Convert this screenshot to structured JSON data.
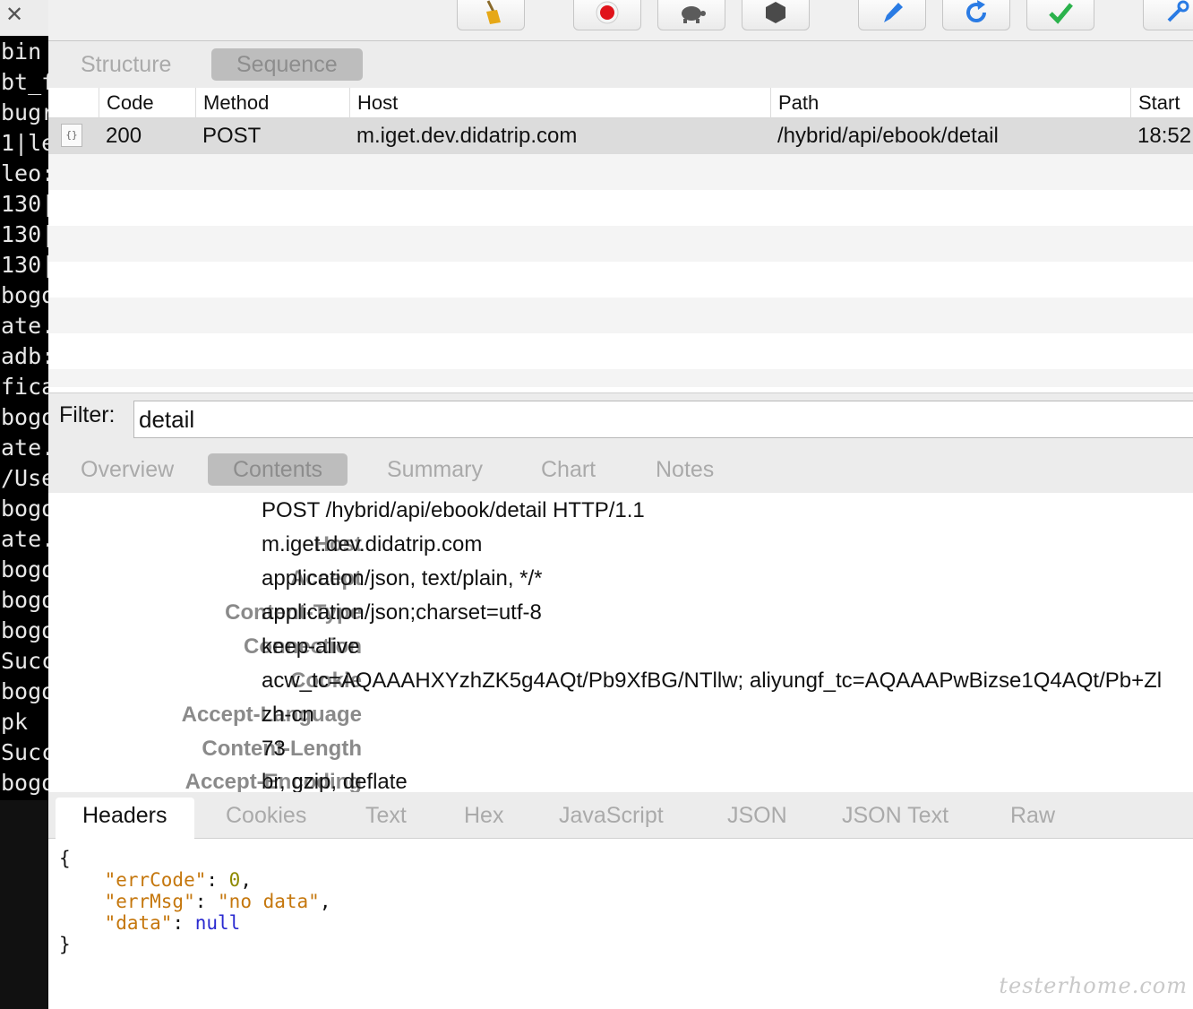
{
  "terminal": {
    "close_glyph": "✕",
    "lines": [
      "bin",
      "bt_f",
      "bugr",
      "1|le",
      "leo:",
      "130|",
      "130|",
      "130|",
      "bogo",
      "ate.",
      "adb:",
      "fica",
      "bogo",
      "ate.",
      "/Use",
      "bogo",
      "ate.",
      "bogo",
      "bogo",
      "bogo",
      "Succ",
      "bogo",
      "pk",
      "Succ",
      "bogo"
    ]
  },
  "toolbar": {
    "buttons": [
      {
        "name": "broom-icon",
        "color": "#e6a817"
      },
      {
        "name": "record-icon",
        "color": "#e0131b"
      },
      {
        "name": "turtle-icon",
        "color": "#5b5b5b"
      },
      {
        "name": "stop-hexagon-icon",
        "color": "#4a4a4a"
      },
      {
        "name": "pen-icon",
        "color": "#2a7be4"
      },
      {
        "name": "refresh-icon",
        "color": "#2a7be4"
      },
      {
        "name": "check-icon",
        "color": "#2bb24c"
      },
      {
        "name": "tools-icon",
        "color": "#2a7be4"
      }
    ]
  },
  "view_tabs": [
    {
      "label": "Structure",
      "active": false
    },
    {
      "label": "Sequence",
      "active": true
    }
  ],
  "table": {
    "columns": [
      "Code",
      "Method",
      "Host",
      "Path",
      "Start"
    ],
    "rows": [
      {
        "icon": "{}",
        "code": "200",
        "method": "POST",
        "host": "m.iget.dev.didatrip.com",
        "path": "/hybrid/api/ebook/detail",
        "start": "18:52"
      }
    ]
  },
  "filter": {
    "label": "Filter:",
    "value": "detail"
  },
  "detail_tabs": [
    {
      "label": "Overview",
      "active": false
    },
    {
      "label": "Contents",
      "active": true
    },
    {
      "label": "Summary",
      "active": false
    },
    {
      "label": "Chart",
      "active": false
    },
    {
      "label": "Notes",
      "active": false
    }
  ],
  "request": {
    "request_line": "POST /hybrid/api/ebook/detail HTTP/1.1",
    "headers": [
      {
        "key": "Host",
        "value": "m.iget.dev.didatrip.com"
      },
      {
        "key": "Accept",
        "value": "application/json, text/plain, */*"
      },
      {
        "key": "Content-Type",
        "value": "application/json;charset=utf-8"
      },
      {
        "key": "Connection",
        "value": "keep-alive"
      },
      {
        "key": "Cookie",
        "value": "acw_tc=AQAAAHXYzhZK5g4AQt/Pb9XfBG/NTllw; aliyungf_tc=AQAAAPwBizse1Q4AQt/Pb+Zl"
      },
      {
        "key": "Accept-Language",
        "value": "zh-cn"
      },
      {
        "key": "Content-Length",
        "value": "73"
      },
      {
        "key": "Accept-Encoding",
        "value": "br, gzip, deflate"
      }
    ]
  },
  "response_tabs": [
    {
      "label": "Headers",
      "active": true
    },
    {
      "label": "Cookies",
      "active": false
    },
    {
      "label": "Text",
      "active": false
    },
    {
      "label": "Hex",
      "active": false
    },
    {
      "label": "JavaScript",
      "active": false
    },
    {
      "label": "JSON",
      "active": false
    },
    {
      "label": "JSON Text",
      "active": false
    },
    {
      "label": "Raw",
      "active": false
    }
  ],
  "json_body": {
    "open": "{",
    "close": "}",
    "entries": [
      {
        "key": "\"errCode\"",
        "value": "0",
        "type": "number",
        "comma": true
      },
      {
        "key": "\"errMsg\"",
        "value": "\"no data\"",
        "type": "string",
        "comma": true
      },
      {
        "key": "\"data\"",
        "value": "null",
        "type": "null",
        "comma": false
      }
    ]
  },
  "watermark": "testerhome.com"
}
